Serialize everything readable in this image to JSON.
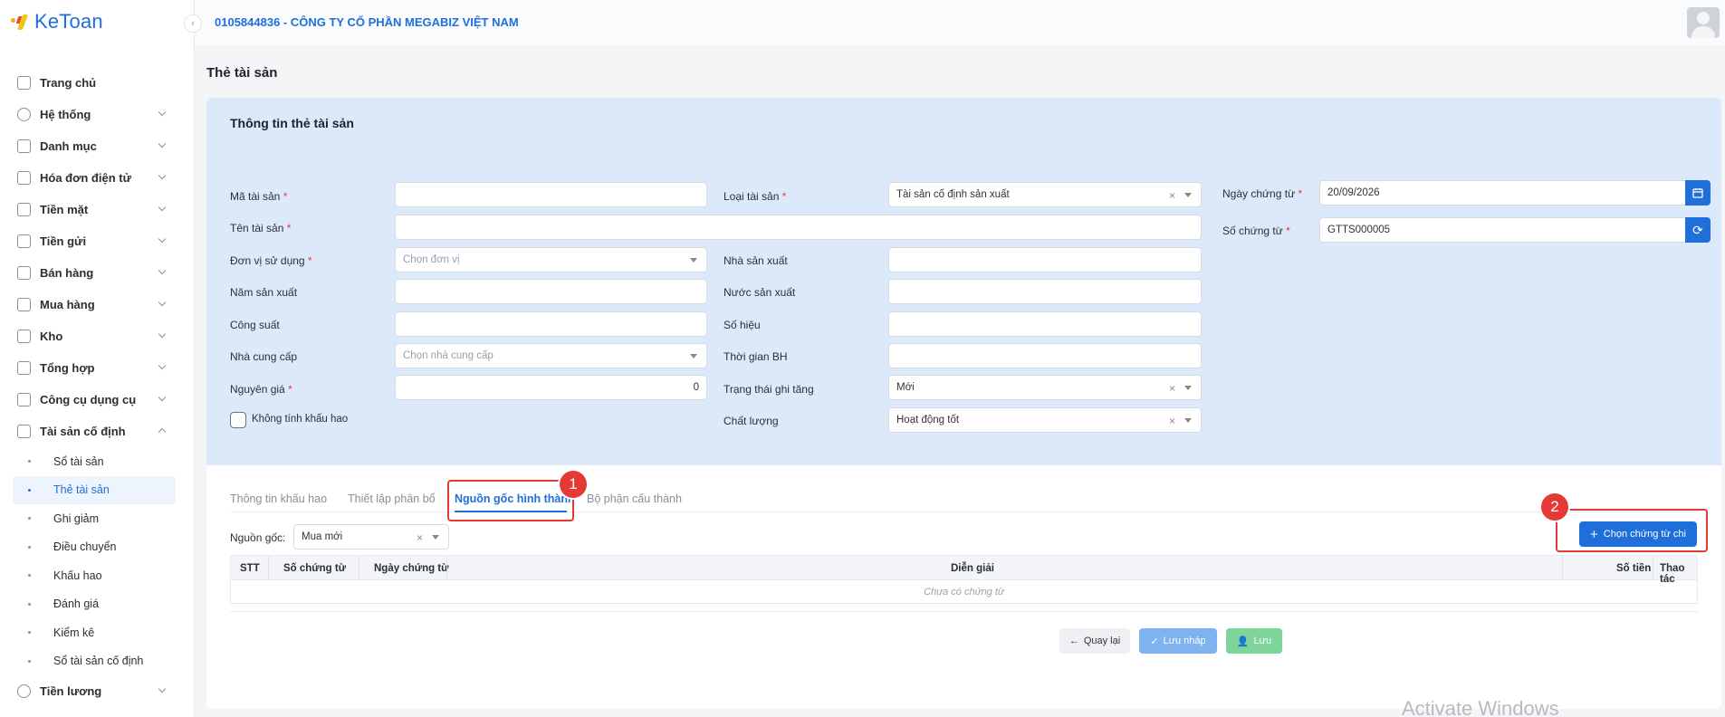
{
  "app": {
    "logo_text": "KeToan"
  },
  "header": {
    "company": "0105844836 - CÔNG TY CỔ PHẦN MEGABIZ VIỆT NAM"
  },
  "sidebar": {
    "items": [
      {
        "label": "Trang chủ",
        "icon": "home-icon"
      },
      {
        "label": "Hệ thống",
        "icon": "gear-icon"
      },
      {
        "label": "Danh mục",
        "icon": "grid-icon"
      },
      {
        "label": "Hóa đơn điện tử",
        "icon": "invoice-icon"
      },
      {
        "label": "Tiền mặt",
        "icon": "cash-icon"
      },
      {
        "label": "Tiền gửi",
        "icon": "card-icon"
      },
      {
        "label": "Bán hàng",
        "icon": "bag-icon"
      },
      {
        "label": "Mua hàng",
        "icon": "cart-icon"
      },
      {
        "label": "Kho",
        "icon": "warehouse-icon"
      },
      {
        "label": "Tổng hợp",
        "icon": "chart-icon"
      },
      {
        "label": "Công cụ dụng cụ",
        "icon": "tools-icon"
      },
      {
        "label": "Tài sản cố định",
        "icon": "car-icon"
      }
    ],
    "sub_items": [
      "Sổ tài sản",
      "Thẻ tài sản",
      "Ghi giảm",
      "Điều chuyển",
      "Khấu hao",
      "Đánh giá",
      "Kiểm kê",
      "Sổ tài sản cố định"
    ],
    "last_item": {
      "label": "Tiền lương",
      "icon": "salary-icon"
    }
  },
  "page": {
    "title": "Thẻ tài sản"
  },
  "form": {
    "section_title": "Thông tin thẻ tài sản",
    "ma_tai_san": {
      "label": "Mã tài sản",
      "value": ""
    },
    "ten_tai_san": {
      "label": "Tên tài sản",
      "value": ""
    },
    "don_vi_su_dung": {
      "label": "Đơn vị sử dụng",
      "placeholder": "Chọn đơn vị"
    },
    "nam_san_xuat": {
      "label": "Năm sản xuất",
      "value": ""
    },
    "cong_suat": {
      "label": "Công suất",
      "value": ""
    },
    "nha_cung_cap": {
      "label": "Nhà cung cấp",
      "placeholder": "Chọn nhà cung cấp"
    },
    "nguyen_gia": {
      "label": "Nguyên giá",
      "value": "0"
    },
    "khong_tinh_khau_hao": {
      "label": "Không tính khấu hao",
      "checked": false
    },
    "loai_tai_san": {
      "label": "Loại tài sản",
      "value": "Tài sản cố định sản xuất"
    },
    "nha_san_xuat": {
      "label": "Nhà sản xuất",
      "value": ""
    },
    "nuoc_san_xuat": {
      "label": "Nước sản xuất",
      "value": ""
    },
    "so_hieu": {
      "label": "Số hiệu",
      "value": ""
    },
    "thoi_gian_bh": {
      "label": "Thời gian BH",
      "value": ""
    },
    "trang_thai_ghi_tang": {
      "label": "Trạng thái ghi tăng",
      "value": "Mới"
    },
    "chat_luong": {
      "label": "Chất lượng",
      "value": "Hoạt động tốt"
    },
    "ngay_chung_tu": {
      "label": "Ngày chứng từ",
      "value": "20/09/2026"
    },
    "so_chung_tu": {
      "label": "Số chứng từ",
      "value": "GTTS000005"
    }
  },
  "tabs": [
    "Thông tin khấu hao",
    "Thiết lập phân bổ",
    "Nguồn gốc hình thành",
    "Bộ phận cấu thành"
  ],
  "active_tab": "Nguồn gốc hình thành",
  "source": {
    "label": "Nguồn gốc:",
    "value": "Mua mới"
  },
  "select_button": "Chọn chứng từ chi",
  "table": {
    "columns": [
      "STT",
      "Số chứng từ",
      "Ngày chứng từ",
      "Diễn giải",
      "Số tiền",
      "Thao tác"
    ],
    "empty_text": "Chưa có chứng từ"
  },
  "footer_buttons": {
    "back": "Quay lại",
    "draft": "Lưu nháp",
    "save": "Lưu"
  },
  "annotations": [
    "1",
    "2"
  ],
  "watermark": "Activate Windows",
  "colors": {
    "primary": "#1e6fd9",
    "header_band": "#dce9fb",
    "annotation": "#e53935"
  }
}
